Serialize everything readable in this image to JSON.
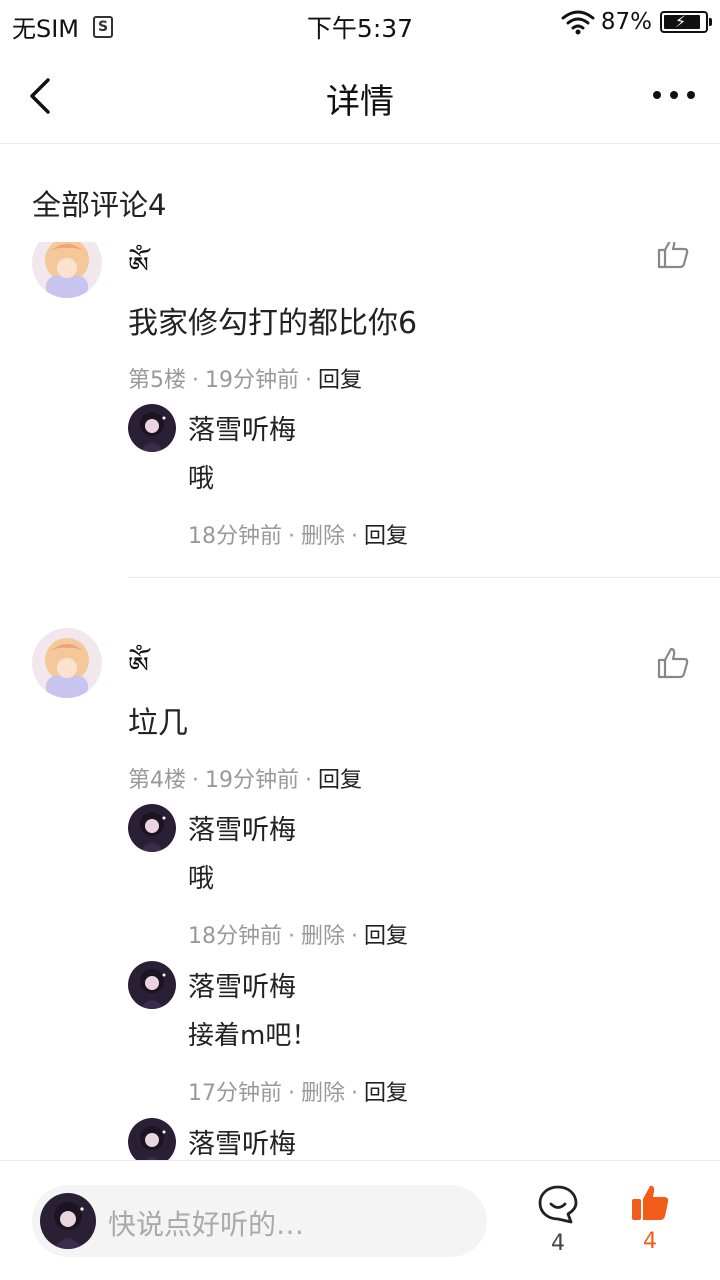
{
  "status_bar": {
    "carrier": "无SIM",
    "time": "下午5:37",
    "battery": "87%"
  },
  "nav": {
    "title": "详情"
  },
  "section": {
    "title": "全部评论4"
  },
  "comments": [
    {
      "author": "ཨོཾ",
      "text": "我家修勾打的都比你6",
      "floor": "第5楼",
      "time": "19分钟前",
      "reply_label": "回复",
      "replies": [
        {
          "author": "落雪听梅",
          "text": "哦",
          "time": "18分钟前",
          "delete_label": "删除",
          "reply_label": "回复"
        }
      ]
    },
    {
      "author": "ཨོཾ",
      "text": "垃几",
      "floor": "第4楼",
      "time": "19分钟前",
      "reply_label": "回复",
      "replies": [
        {
          "author": "落雪听梅",
          "text": "哦",
          "time": "18分钟前",
          "delete_label": "删除",
          "reply_label": "回复"
        },
        {
          "author": "落雪听梅",
          "text": "接着m吧！",
          "time": "17分钟前",
          "delete_label": "删除",
          "reply_label": "回复"
        },
        {
          "author": "落雪听梅"
        }
      ]
    }
  ],
  "bottom_bar": {
    "input_placeholder": "快说点好听的…",
    "comment_count": "4",
    "like_count": "4"
  },
  "colors": {
    "accent": "#f25c19",
    "meta_text": "#999999",
    "divider": "#ececec"
  }
}
